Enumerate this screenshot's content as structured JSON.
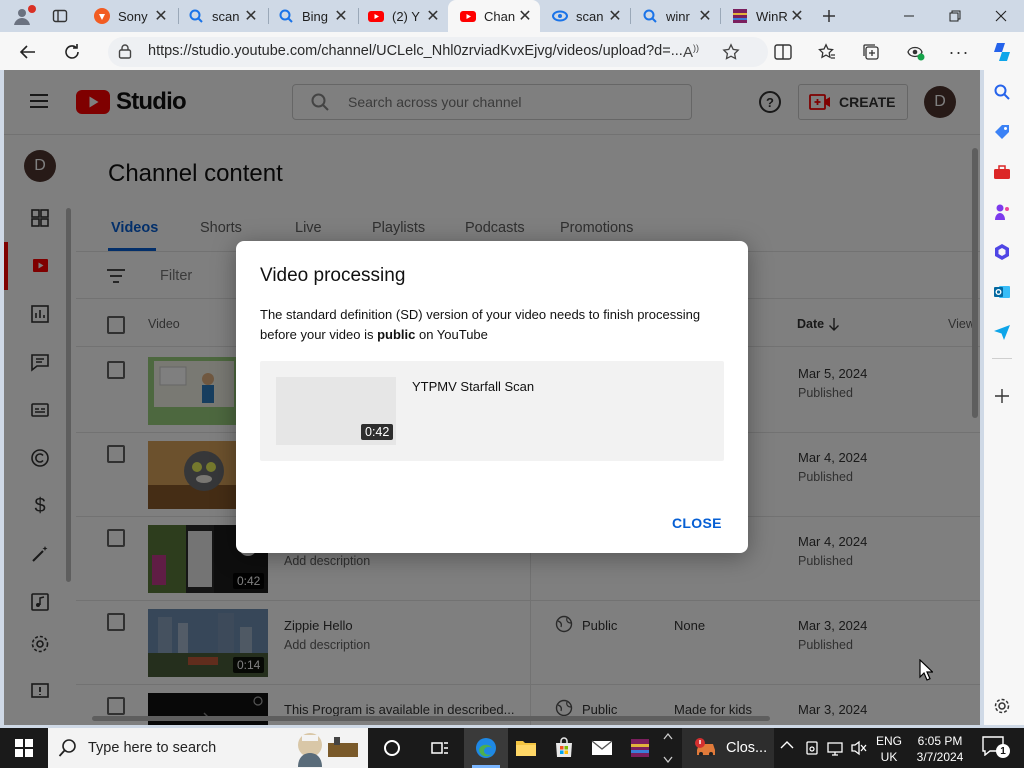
{
  "browser": {
    "tabs": [
      {
        "label": "Sony",
        "icon": "brave-icon"
      },
      {
        "label": "scan",
        "icon": "bing-search-icon"
      },
      {
        "label": "Bing",
        "icon": "bing-search-icon"
      },
      {
        "label": "(2) Y",
        "icon": "youtube-icon"
      },
      {
        "label": "Chan",
        "icon": "youtube-icon",
        "active": true
      },
      {
        "label": "scan",
        "icon": "scan-icon"
      },
      {
        "label": "winr",
        "icon": "bing-search-icon"
      },
      {
        "label": "WinR",
        "icon": "winrar-icon"
      }
    ],
    "url": "https://studio.youtube.com/channel/UCLelc_Nhl0zrviadKvxEjvg/videos/upload?d=..."
  },
  "studio": {
    "logo_text": "Studio",
    "search_placeholder": "Search across your channel",
    "create_label": "CREATE",
    "avatar_letter": "D",
    "page_title": "Channel content",
    "tabs": [
      "Videos",
      "Shorts",
      "Live",
      "Playlists",
      "Podcasts",
      "Promotions"
    ],
    "filter_label": "Filter",
    "columns": {
      "video": "Video",
      "date": "Date",
      "views": "Views"
    },
    "rows": [
      {
        "title": "",
        "desc": "",
        "visibility": "",
        "restrictions": "",
        "date": "Mar 5, 2024",
        "status": "Published",
        "duration": ""
      },
      {
        "title": "",
        "desc": "",
        "visibility": "",
        "restrictions": "",
        "date": "Mar 4, 2024",
        "status": "Published",
        "duration": ""
      },
      {
        "title": "",
        "desc": "Add description",
        "visibility": "",
        "restrictions": "",
        "date": "Mar 4, 2024",
        "status": "Published",
        "duration": "0:42"
      },
      {
        "title": "Zippie Hello",
        "desc": "Add description",
        "visibility": "Public",
        "restrictions": "None",
        "date": "Mar 3, 2024",
        "status": "Published",
        "duration": "0:14"
      },
      {
        "title": "This Program is available in described...",
        "desc": "",
        "visibility": "Public",
        "restrictions": "Made for kids",
        "date": "Mar 3, 2024",
        "status": "",
        "duration": ""
      }
    ],
    "partial_s": "s",
    "colors": {
      "accent": "#065fd4",
      "youtube_red": "#ff0000"
    }
  },
  "dialog": {
    "title": "Video processing",
    "body_before": "The standard definition (SD) version of your video needs to finish processing before your video is ",
    "body_bold": "public",
    "body_after": " on YouTube",
    "video_title": "YTPMV Starfall Scan",
    "video_duration": "0:42",
    "close_label": "CLOSE"
  },
  "taskbar": {
    "search_placeholder": "Type here to search",
    "app_label": "Clos...",
    "lang_top": "ENG",
    "lang_bottom": "UK",
    "time": "6:05 PM",
    "date": "3/7/2024",
    "notif_count": "1"
  }
}
